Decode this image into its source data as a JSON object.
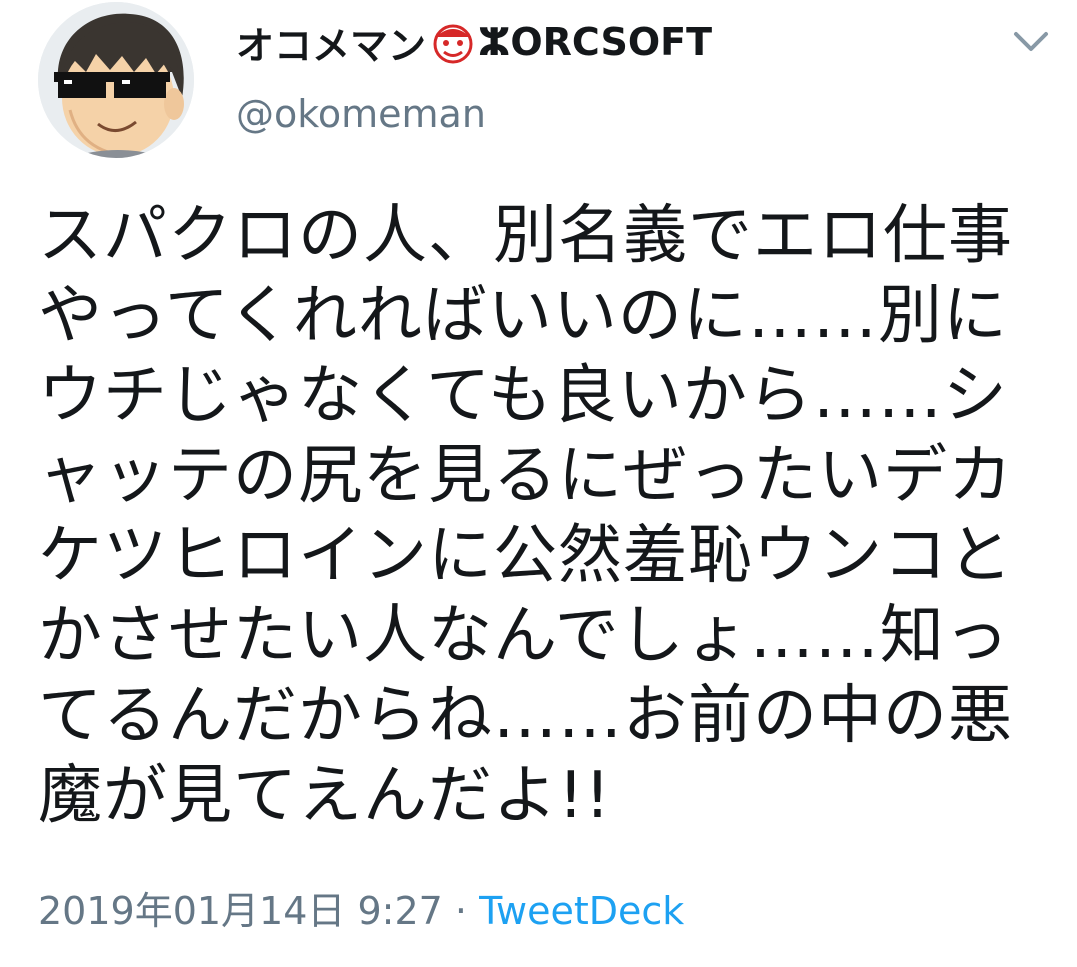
{
  "user": {
    "display_name": "オコメマン",
    "brand": "ⵣORCSOFT",
    "handle": "@okomeman",
    "avatar_icon": "cartoon-man-sunglasses-avatar",
    "name_icon": "red-mascot-face-icon"
  },
  "menu": {
    "caret_icon": "chevron-down-icon"
  },
  "tweet": {
    "lines": [
      "スパクロの人、別名義でエロ仕事",
      "やってくれればいいのに……別に",
      "ウチじゃなくても良いから……シ",
      "ャッテの尻を見るにぜったいデカ",
      "ケツヒロインに公然羞恥ウンコと",
      "かさせたい人なんでしょ……知っ",
      "てるんだからね……お前の中の悪",
      "魔が見てえんだよ!!"
    ]
  },
  "meta": {
    "timestamp": "2019年01月14日 9:27",
    "separator": " · ",
    "source": "TweetDeck"
  },
  "colors": {
    "text": "#14171a",
    "secondary": "#657786",
    "link": "#1da1f2"
  }
}
